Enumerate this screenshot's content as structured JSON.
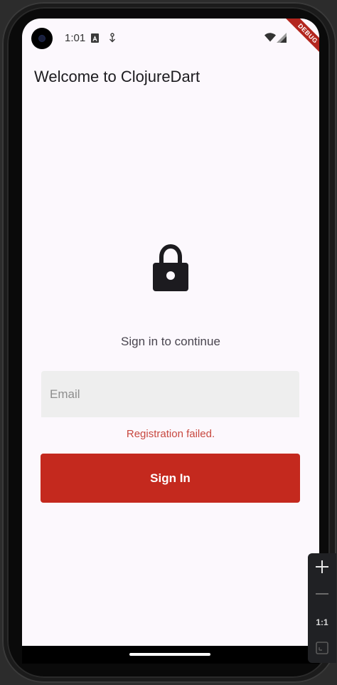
{
  "status_bar": {
    "time": "1:01",
    "icons": [
      "a-box-icon",
      "download-arrow-icon",
      "wifi-icon",
      "signal-icon"
    ]
  },
  "debug_banner": {
    "label": "DEBUG"
  },
  "app_bar": {
    "title": "Welcome to ClojureDart"
  },
  "login": {
    "icon": "lock-icon",
    "subtitle": "Sign in to continue",
    "email_placeholder": "Email",
    "email_value": "",
    "error_message": "Registration failed.",
    "sign_in_label": "Sign In"
  },
  "emulator_toolbar": {
    "actual_size_label": "1:1"
  },
  "colors": {
    "primary": "#c4291e",
    "error": "#c8483f",
    "background": "#fcf8fd",
    "field": "#eeeeee"
  }
}
